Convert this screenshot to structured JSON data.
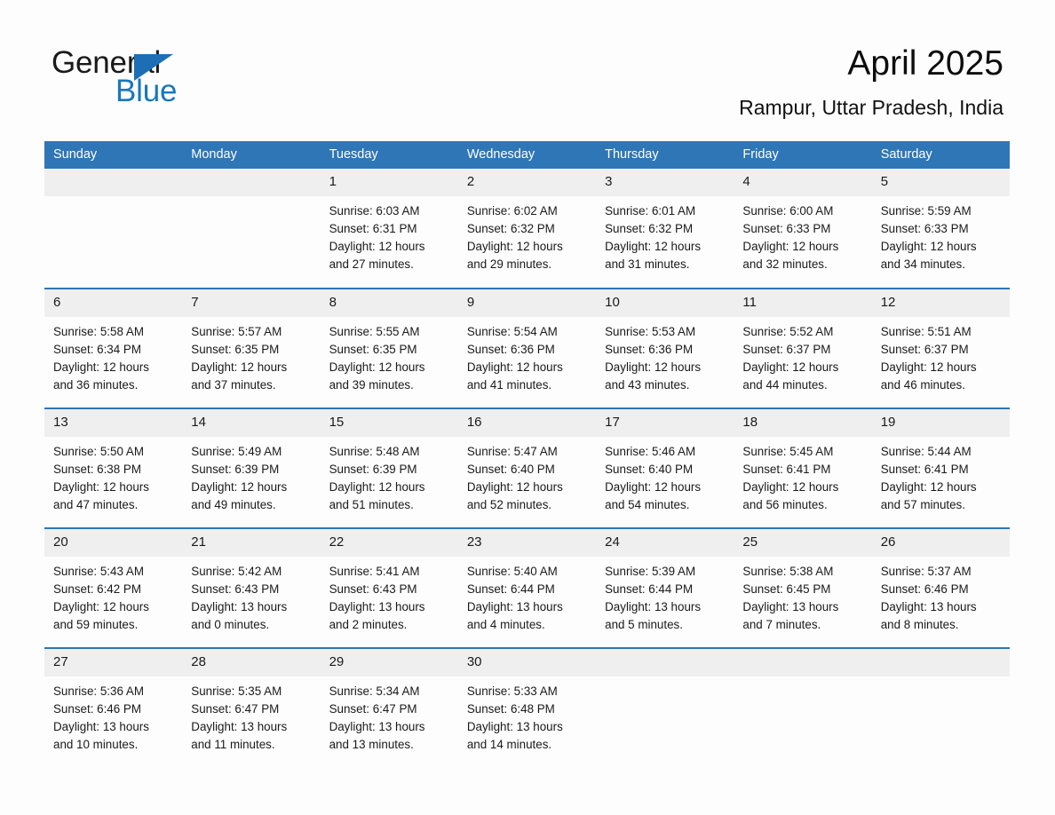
{
  "brand": {
    "name_part1": "General",
    "name_part2": "Blue",
    "triangle_icon": "triangle-icon",
    "accent_color": "#1c6fb4"
  },
  "header": {
    "title": "April 2025",
    "location": "Rampur, Uttar Pradesh, India"
  },
  "colors": {
    "header_blue": "#2f76b6",
    "daynum_gray": "#efefef",
    "page_background": "#fdfdfd",
    "text": "#1a1a1a"
  },
  "weekdays": [
    "Sunday",
    "Monday",
    "Tuesday",
    "Wednesday",
    "Thursday",
    "Friday",
    "Saturday"
  ],
  "calendar": {
    "month": "April",
    "year": "2025",
    "weeks": [
      [
        {
          "day": "",
          "sunrise": "",
          "sunset": "",
          "daylight_1": "",
          "daylight_2": ""
        },
        {
          "day": "",
          "sunrise": "",
          "sunset": "",
          "daylight_1": "",
          "daylight_2": ""
        },
        {
          "day": "1",
          "sunrise": "Sunrise: 6:03 AM",
          "sunset": "Sunset: 6:31 PM",
          "daylight_1": "Daylight: 12 hours",
          "daylight_2": "and 27 minutes."
        },
        {
          "day": "2",
          "sunrise": "Sunrise: 6:02 AM",
          "sunset": "Sunset: 6:32 PM",
          "daylight_1": "Daylight: 12 hours",
          "daylight_2": "and 29 minutes."
        },
        {
          "day": "3",
          "sunrise": "Sunrise: 6:01 AM",
          "sunset": "Sunset: 6:32 PM",
          "daylight_1": "Daylight: 12 hours",
          "daylight_2": "and 31 minutes."
        },
        {
          "day": "4",
          "sunrise": "Sunrise: 6:00 AM",
          "sunset": "Sunset: 6:33 PM",
          "daylight_1": "Daylight: 12 hours",
          "daylight_2": "and 32 minutes."
        },
        {
          "day": "5",
          "sunrise": "Sunrise: 5:59 AM",
          "sunset": "Sunset: 6:33 PM",
          "daylight_1": "Daylight: 12 hours",
          "daylight_2": "and 34 minutes."
        }
      ],
      [
        {
          "day": "6",
          "sunrise": "Sunrise: 5:58 AM",
          "sunset": "Sunset: 6:34 PM",
          "daylight_1": "Daylight: 12 hours",
          "daylight_2": "and 36 minutes."
        },
        {
          "day": "7",
          "sunrise": "Sunrise: 5:57 AM",
          "sunset": "Sunset: 6:35 PM",
          "daylight_1": "Daylight: 12 hours",
          "daylight_2": "and 37 minutes."
        },
        {
          "day": "8",
          "sunrise": "Sunrise: 5:55 AM",
          "sunset": "Sunset: 6:35 PM",
          "daylight_1": "Daylight: 12 hours",
          "daylight_2": "and 39 minutes."
        },
        {
          "day": "9",
          "sunrise": "Sunrise: 5:54 AM",
          "sunset": "Sunset: 6:36 PM",
          "daylight_1": "Daylight: 12 hours",
          "daylight_2": "and 41 minutes."
        },
        {
          "day": "10",
          "sunrise": "Sunrise: 5:53 AM",
          "sunset": "Sunset: 6:36 PM",
          "daylight_1": "Daylight: 12 hours",
          "daylight_2": "and 43 minutes."
        },
        {
          "day": "11",
          "sunrise": "Sunrise: 5:52 AM",
          "sunset": "Sunset: 6:37 PM",
          "daylight_1": "Daylight: 12 hours",
          "daylight_2": "and 44 minutes."
        },
        {
          "day": "12",
          "sunrise": "Sunrise: 5:51 AM",
          "sunset": "Sunset: 6:37 PM",
          "daylight_1": "Daylight: 12 hours",
          "daylight_2": "and 46 minutes."
        }
      ],
      [
        {
          "day": "13",
          "sunrise": "Sunrise: 5:50 AM",
          "sunset": "Sunset: 6:38 PM",
          "daylight_1": "Daylight: 12 hours",
          "daylight_2": "and 47 minutes."
        },
        {
          "day": "14",
          "sunrise": "Sunrise: 5:49 AM",
          "sunset": "Sunset: 6:39 PM",
          "daylight_1": "Daylight: 12 hours",
          "daylight_2": "and 49 minutes."
        },
        {
          "day": "15",
          "sunrise": "Sunrise: 5:48 AM",
          "sunset": "Sunset: 6:39 PM",
          "daylight_1": "Daylight: 12 hours",
          "daylight_2": "and 51 minutes."
        },
        {
          "day": "16",
          "sunrise": "Sunrise: 5:47 AM",
          "sunset": "Sunset: 6:40 PM",
          "daylight_1": "Daylight: 12 hours",
          "daylight_2": "and 52 minutes."
        },
        {
          "day": "17",
          "sunrise": "Sunrise: 5:46 AM",
          "sunset": "Sunset: 6:40 PM",
          "daylight_1": "Daylight: 12 hours",
          "daylight_2": "and 54 minutes."
        },
        {
          "day": "18",
          "sunrise": "Sunrise: 5:45 AM",
          "sunset": "Sunset: 6:41 PM",
          "daylight_1": "Daylight: 12 hours",
          "daylight_2": "and 56 minutes."
        },
        {
          "day": "19",
          "sunrise": "Sunrise: 5:44 AM",
          "sunset": "Sunset: 6:41 PM",
          "daylight_1": "Daylight: 12 hours",
          "daylight_2": "and 57 minutes."
        }
      ],
      [
        {
          "day": "20",
          "sunrise": "Sunrise: 5:43 AM",
          "sunset": "Sunset: 6:42 PM",
          "daylight_1": "Daylight: 12 hours",
          "daylight_2": "and 59 minutes."
        },
        {
          "day": "21",
          "sunrise": "Sunrise: 5:42 AM",
          "sunset": "Sunset: 6:43 PM",
          "daylight_1": "Daylight: 13 hours",
          "daylight_2": "and 0 minutes."
        },
        {
          "day": "22",
          "sunrise": "Sunrise: 5:41 AM",
          "sunset": "Sunset: 6:43 PM",
          "daylight_1": "Daylight: 13 hours",
          "daylight_2": "and 2 minutes."
        },
        {
          "day": "23",
          "sunrise": "Sunrise: 5:40 AM",
          "sunset": "Sunset: 6:44 PM",
          "daylight_1": "Daylight: 13 hours",
          "daylight_2": "and 4 minutes."
        },
        {
          "day": "24",
          "sunrise": "Sunrise: 5:39 AM",
          "sunset": "Sunset: 6:44 PM",
          "daylight_1": "Daylight: 13 hours",
          "daylight_2": "and 5 minutes."
        },
        {
          "day": "25",
          "sunrise": "Sunrise: 5:38 AM",
          "sunset": "Sunset: 6:45 PM",
          "daylight_1": "Daylight: 13 hours",
          "daylight_2": "and 7 minutes."
        },
        {
          "day": "26",
          "sunrise": "Sunrise: 5:37 AM",
          "sunset": "Sunset: 6:46 PM",
          "daylight_1": "Daylight: 13 hours",
          "daylight_2": "and 8 minutes."
        }
      ],
      [
        {
          "day": "27",
          "sunrise": "Sunrise: 5:36 AM",
          "sunset": "Sunset: 6:46 PM",
          "daylight_1": "Daylight: 13 hours",
          "daylight_2": "and 10 minutes."
        },
        {
          "day": "28",
          "sunrise": "Sunrise: 5:35 AM",
          "sunset": "Sunset: 6:47 PM",
          "daylight_1": "Daylight: 13 hours",
          "daylight_2": "and 11 minutes."
        },
        {
          "day": "29",
          "sunrise": "Sunrise: 5:34 AM",
          "sunset": "Sunset: 6:47 PM",
          "daylight_1": "Daylight: 13 hours",
          "daylight_2": "and 13 minutes."
        },
        {
          "day": "30",
          "sunrise": "Sunrise: 5:33 AM",
          "sunset": "Sunset: 6:48 PM",
          "daylight_1": "Daylight: 13 hours",
          "daylight_2": "and 14 minutes."
        },
        {
          "day": "",
          "sunrise": "",
          "sunset": "",
          "daylight_1": "",
          "daylight_2": ""
        },
        {
          "day": "",
          "sunrise": "",
          "sunset": "",
          "daylight_1": "",
          "daylight_2": ""
        },
        {
          "day": "",
          "sunrise": "",
          "sunset": "",
          "daylight_1": "",
          "daylight_2": ""
        }
      ]
    ]
  }
}
